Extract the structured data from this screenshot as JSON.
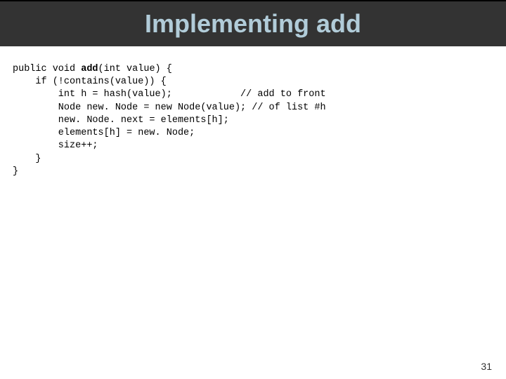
{
  "title": "Implementing add",
  "code": {
    "line1_a": "public void ",
    "line1_b": "add",
    "line1_c": "(int value) {",
    "line2": "    if (!contains(value)) {",
    "line3": "        int h = hash(value);            // add to front",
    "line4": "        Node new. Node = new Node(value); // of list #h",
    "line5": "        new. Node. next = elements[h];",
    "line6": "        elements[h] = new. Node;",
    "line7": "        size++;",
    "line8": "    }",
    "line9": "}"
  },
  "page_number": "31"
}
